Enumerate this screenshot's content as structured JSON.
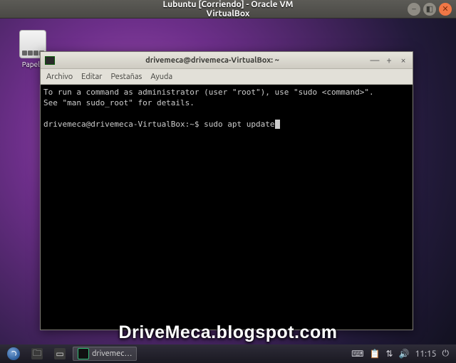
{
  "vbox": {
    "title": "Lubuntu [Corriendo] - Oracle VM VirtualBox"
  },
  "desktop": {
    "icons": [
      {
        "name": "calculator",
        "label": "Papele"
      }
    ]
  },
  "terminal": {
    "title": "drivemeca@drivemeca-VirtualBox: ~",
    "menu": {
      "file": "Archivo",
      "edit": "Editar",
      "tabs": "Pestañas",
      "help": "Ayuda"
    },
    "line1": "To run a command as administrator (user \"root\"), use \"sudo <command>\".",
    "line2": "See \"man sudo_root\" for details.",
    "prompt": "drivemeca@drivemeca-VirtualBox:~$ ",
    "command": "sudo apt update"
  },
  "taskbar": {
    "task_label": "drivemec…",
    "clock": "11:15"
  },
  "watermark": "DriveMeca.blogspot.com"
}
